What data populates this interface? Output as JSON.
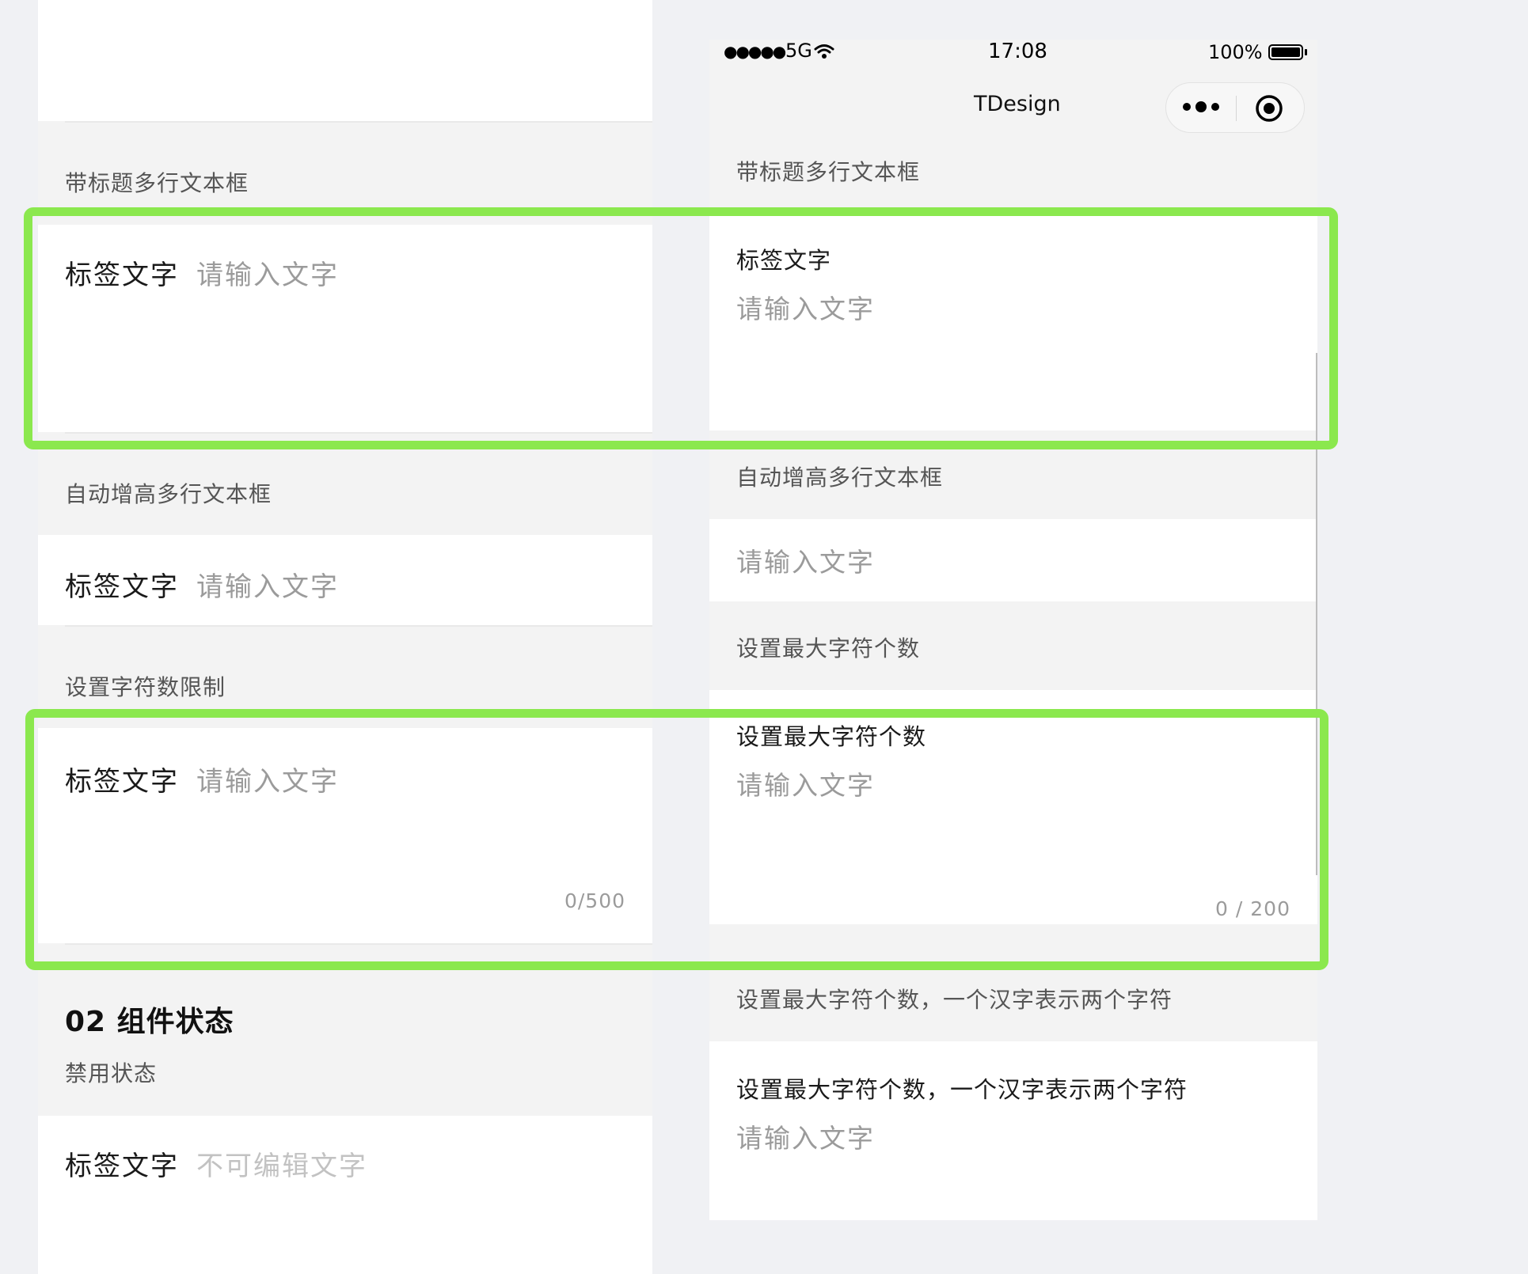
{
  "left": {
    "section_titled_multiline": "带标题多行文本框",
    "section_autosize": "自动增高多行文本框",
    "section_char_limit": "设置字符数限制",
    "field_label": "标签文字",
    "placeholder": "请输入文字",
    "counter": "0/500",
    "states_heading": "02 组件状态",
    "disabled_title": "禁用状态",
    "disabled_value": "不可编辑文字"
  },
  "phone": {
    "status_bar": {
      "signal": "●●●●●",
      "network": "5G",
      "time": "17:08",
      "battery": "100%"
    },
    "nav_title": "TDesign",
    "section_titled_multiline": "带标题多行文本框",
    "field_label": "标签文字",
    "placeholder": "请输入文字",
    "section_autosize": "自动增高多行文本框",
    "section_max_chars": "设置最大字符个数",
    "max_chars_label": "设置最大字符个数",
    "max_chars_counter": "0 / 200",
    "section_max_chars_cn": "设置最大字符个数，一个汉字表示两个字符",
    "max_chars_cn_label": "设置最大字符个数，一个汉字表示两个字符"
  },
  "colors": {
    "highlight": "#8be84e",
    "page_bg": "#f0f1f4",
    "panel_bg": "#f3f3f3"
  }
}
